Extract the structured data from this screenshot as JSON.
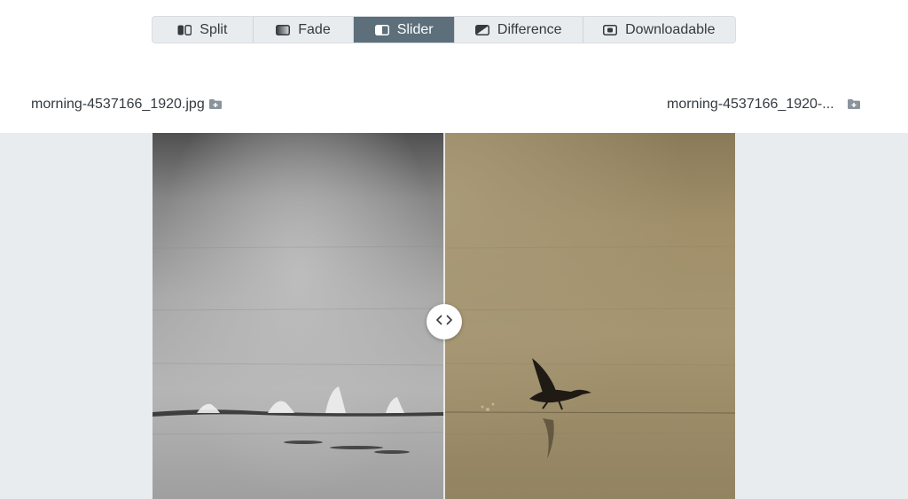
{
  "modes": [
    {
      "label": "Split",
      "icon": "split-icon"
    },
    {
      "label": "Fade",
      "icon": "fade-icon"
    },
    {
      "label": "Slider",
      "icon": "slider-icon",
      "active": true
    },
    {
      "label": "Difference",
      "icon": "difference-icon"
    },
    {
      "label": "Downloadable",
      "icon": "downloadable-icon"
    }
  ],
  "files": {
    "left": {
      "name": "morning-4537166_1920.jpg",
      "icon": "folder-plus-icon"
    },
    "right": {
      "name": "morning-4537166_1920-...",
      "icon": "folder-plus-icon"
    }
  },
  "viewer": {
    "slider_position": 0.5,
    "before_tone": "grayscale",
    "after_tone": "sepia"
  },
  "colors": {
    "active_tab": "#5c6f7b",
    "tab_bg": "#e9ecef",
    "stage_bg": "#e9ecef"
  }
}
